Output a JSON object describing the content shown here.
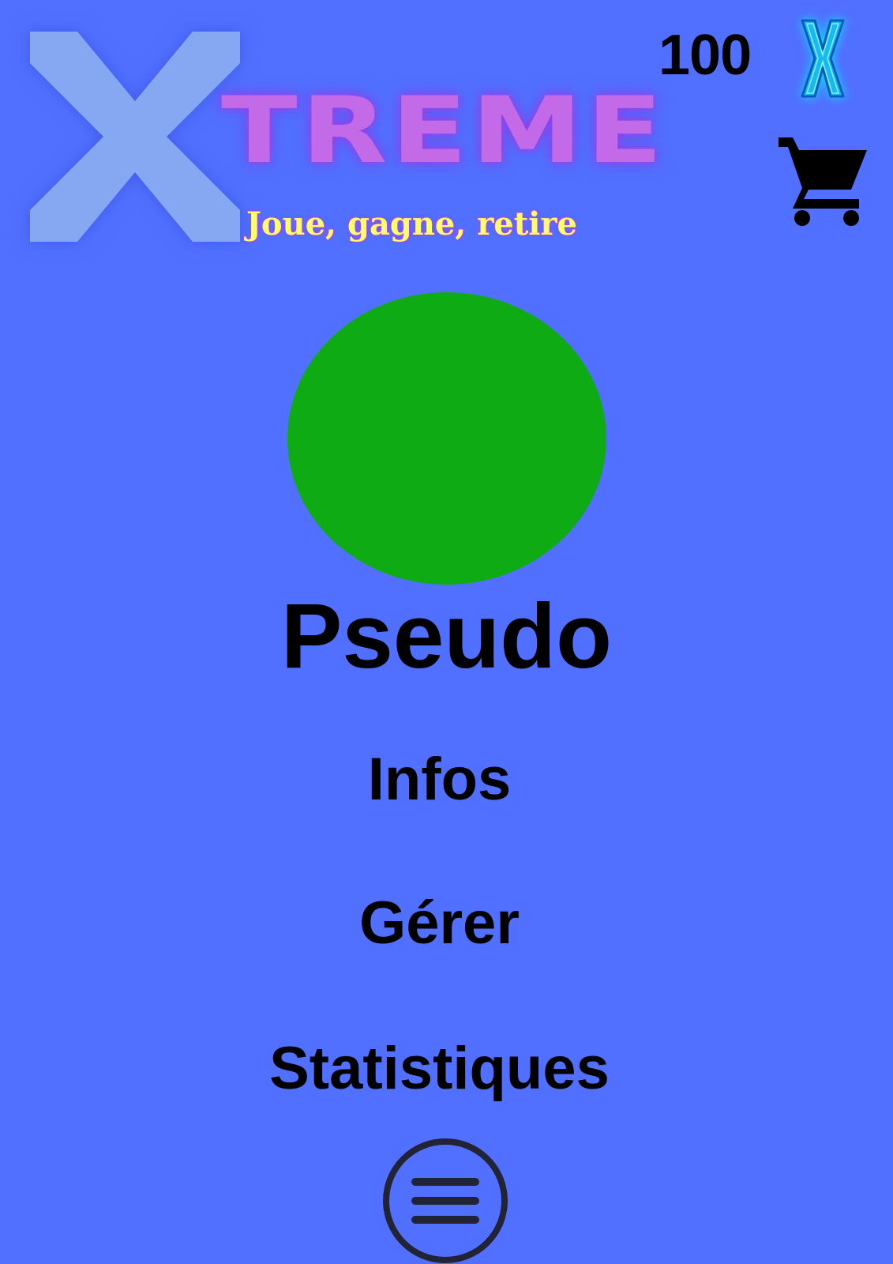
{
  "header": {
    "logo": {
      "letter": "X",
      "word": "TREME",
      "tagline": "Joue, gagne, retire"
    },
    "balance": "100",
    "currency_icon": "x-coin-icon",
    "cart_icon": "shopping-cart-icon"
  },
  "profile": {
    "avatar_color": "#0fab14",
    "username": "Pseudo"
  },
  "menu": {
    "items": [
      {
        "label": "Infos"
      },
      {
        "label": "Gérer"
      },
      {
        "label": "Statistiques"
      }
    ],
    "toggle_icon": "hamburger-menu-icon"
  },
  "colors": {
    "background": "#5170ff",
    "logo_x": "#86a8f3",
    "logo_word": "#c36ae8",
    "tagline": "#fbff6a",
    "coin_x": "#1ab8f0",
    "text": "#000000"
  }
}
